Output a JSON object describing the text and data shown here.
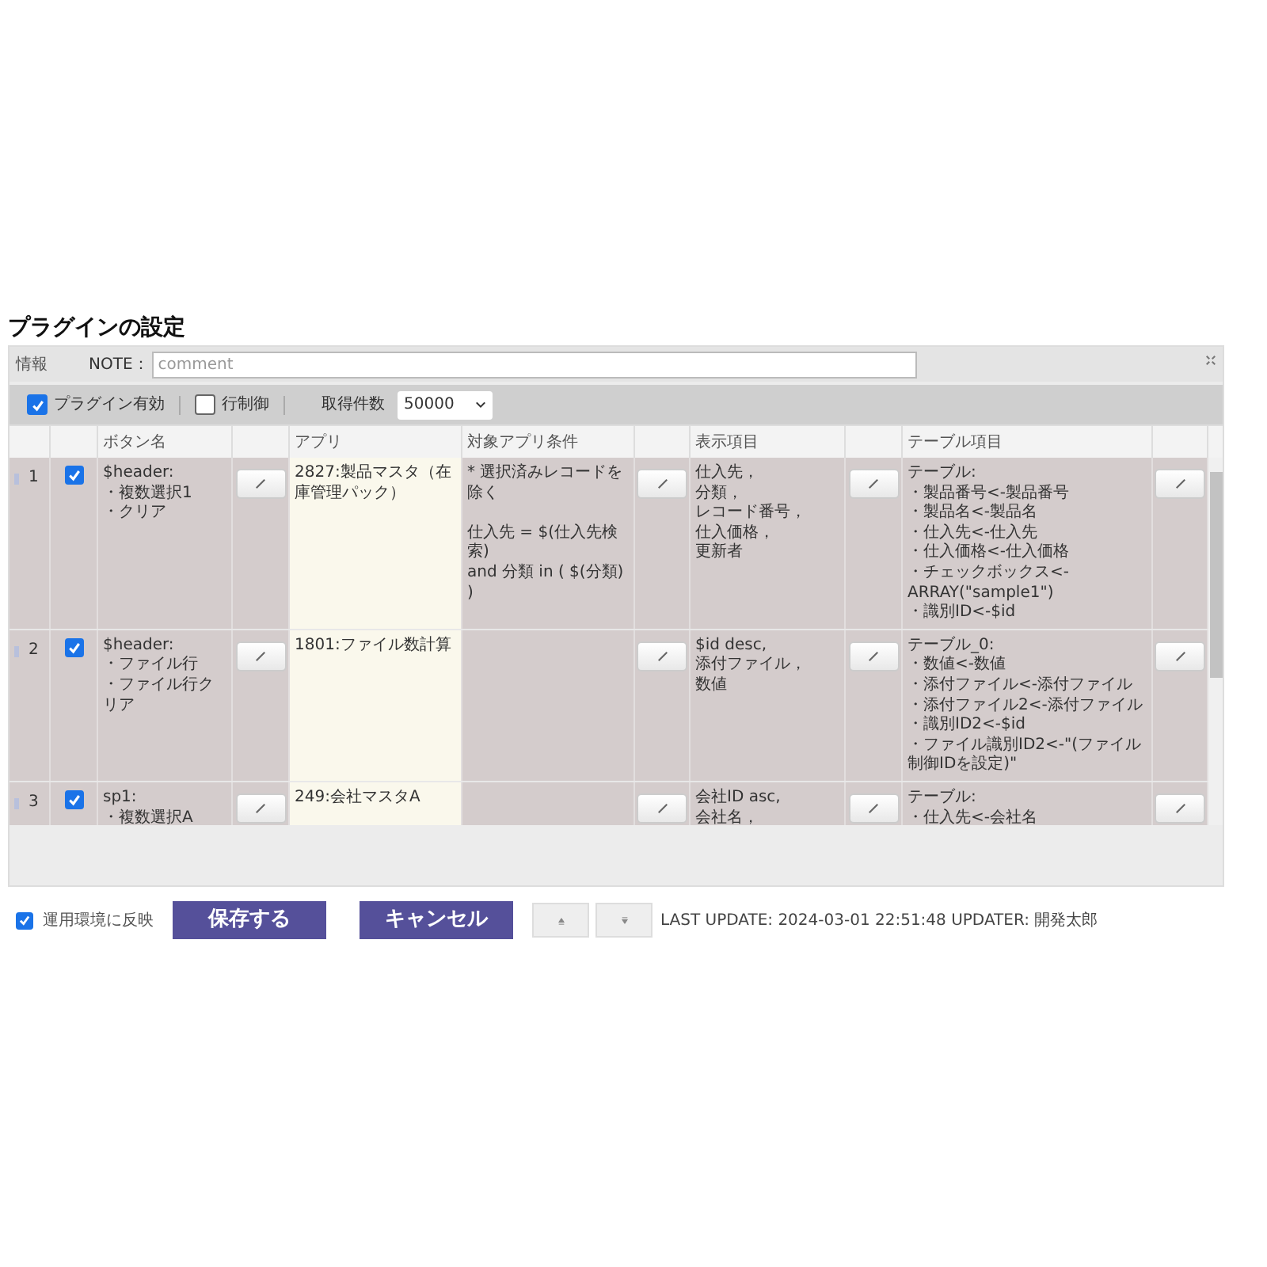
{
  "title": "プラグインの設定",
  "info": {
    "label": "情報",
    "note_label": "NOTE：",
    "note_placeholder": "comment"
  },
  "options": {
    "plugin_enabled": {
      "label": "プラグイン有効",
      "checked": true
    },
    "row_control": {
      "label": "行制御",
      "checked": false
    },
    "fetch_count": {
      "label": "取得件数",
      "value": "50000"
    }
  },
  "table": {
    "columns": [
      "ボタン名",
      "アプリ",
      "対象アプリ条件",
      "表示項目",
      "テーブル項目"
    ],
    "rows": [
      {
        "number": "1",
        "checked": true,
        "button_name": [
          "$header:",
          "・複数選択1",
          "・クリア"
        ],
        "app": "2827:製品マスタ（在庫管理パック）",
        "condition": [
          [
            "* 選択済みレコードを除く"
          ],
          [
            "仕入先 = $(仕入先検索)",
            "and 分類 in ( $(分類) )"
          ]
        ],
        "display": [
          "仕入先，",
          "分類，",
          "レコード番号，",
          "仕入価格，",
          "更新者"
        ],
        "table_items": [
          "テーブル:",
          "・製品番号<-製品番号",
          "・製品名<-製品名",
          "・仕入先<-仕入先",
          "・仕入価格<-仕入価格",
          "・チェックボックス<-ARRAY(\"sample1\")",
          "・識別ID<-$id"
        ]
      },
      {
        "number": "2",
        "checked": true,
        "button_name": [
          "$header:",
          "・ファイル行",
          "・ファイル行クリア"
        ],
        "app": "1801:ファイル数計算",
        "display": [
          "$id desc,",
          "添付ファイル，",
          "数値"
        ],
        "table_items": [
          "テーブル_0:",
          "・数値<-数値",
          "・添付ファイル<-添付ファイル",
          "・添付ファイル2<-添付ファイル",
          "・識別ID2<-$id",
          "・ファイル識別ID2<-\"(ファイル制御IDを設定)\""
        ]
      },
      {
        "number": "3",
        "checked": true,
        "button_name": [
          "sp1:",
          "・複数選択A"
        ],
        "app": "249:会社マスタA",
        "display": [
          "会社ID asc,",
          "会社名，"
        ],
        "table_items": [
          "テーブル:",
          "・仕入先<-会社名"
        ]
      }
    ]
  },
  "footer": {
    "deploy": {
      "label": "運用環境に反映",
      "checked": true
    },
    "save": "保存する",
    "cancel": "キャンセル",
    "last_update": "LAST UPDATE: 2024-03-01 22:51:48 UPDATER: 開発太郎"
  }
}
